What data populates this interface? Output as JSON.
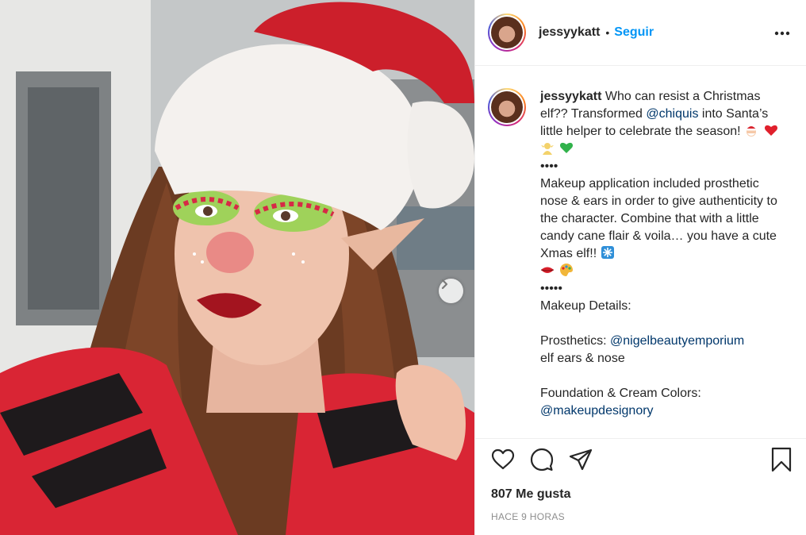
{
  "post": {
    "image_alt": "",
    "carousel_next_icon": "chevron-right-icon"
  },
  "header": {
    "username": "jessyykatt",
    "separator": "•",
    "follow_label": "Seguir",
    "more_icon": "more-horizontal-icon"
  },
  "caption": {
    "username": "jessyykatt",
    "line1": "Who can resist a Christmas elf?? Transformed ",
    "mention1": "@chiquis",
    "line2": " into Santa’s little helper to celebrate the season! ",
    "dots1": "••••",
    "para2": "Makeup application included prosthetic nose & ears in order to give authenticity to the character. Combine that with a little candy cane flair & voila… you have a cute Xmas elf!! ",
    "dots2": "•••••",
    "details_title": "Makeup Details:",
    "prosthetics_label": "Prosthetics: ",
    "mention2": "@nigelbeautyemporium",
    "prosthetics_desc": "elf ears & nose",
    "foundation_label": "Foundation & Cream Colors:",
    "mention3": "@makeupdesignory"
  },
  "actions": {
    "like_icon": "heart-icon",
    "comment_icon": "comment-icon",
    "share_icon": "paper-plane-icon",
    "save_icon": "bookmark-icon"
  },
  "likes_text": "807 Me gusta",
  "timestamp": "HACE 9 HORAS",
  "colors": {
    "accent": "#0095f6",
    "mention": "#00376b",
    "text": "#262626",
    "muted": "#8e8e8e",
    "border": "#efefef"
  }
}
